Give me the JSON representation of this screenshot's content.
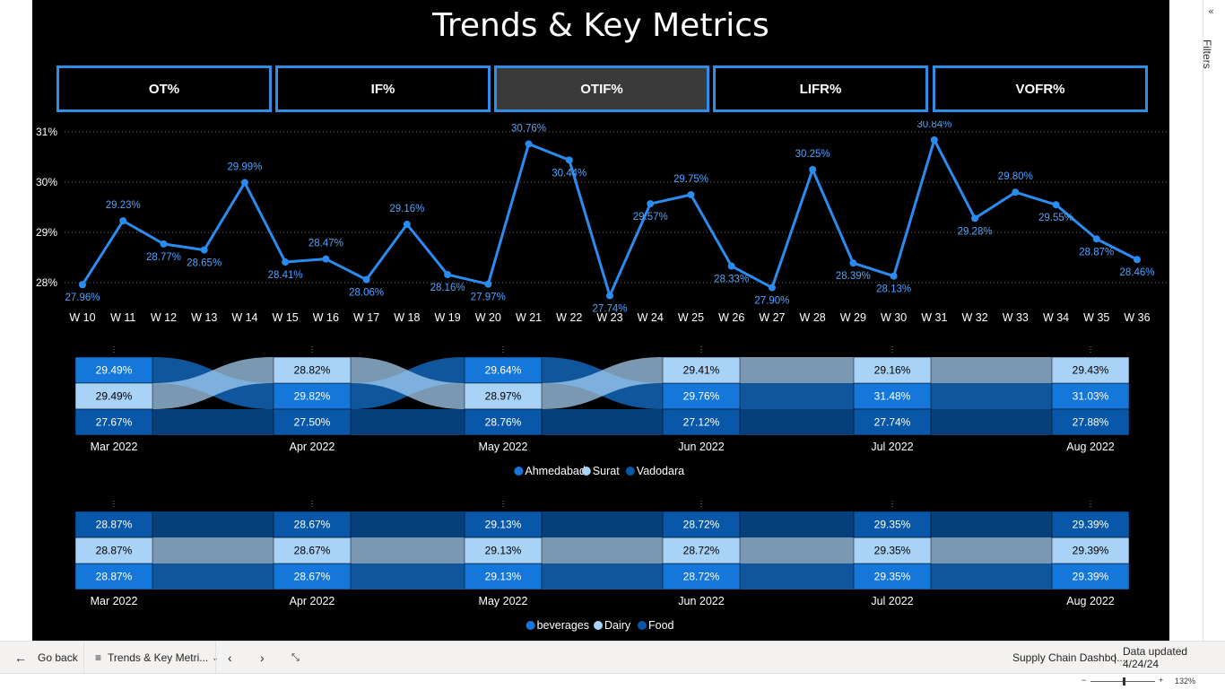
{
  "title": "Trends & Key Metrics",
  "metrics": [
    {
      "label": "OT%",
      "active": false
    },
    {
      "label": "IF%",
      "active": false
    },
    {
      "label": "OTIF%",
      "active": true
    },
    {
      "label": "LIFR%",
      "active": false
    },
    {
      "label": "VOFR%",
      "active": false
    }
  ],
  "colors": {
    "accent": "#2f8fe8",
    "line": "#2b8cf0",
    "label": "#4ea3ff",
    "dark": "#0857a8",
    "mid": "#1577d9",
    "light": "#a9d2f7"
  },
  "chart_data": [
    {
      "type": "line",
      "categories": [
        "W 10",
        "W 11",
        "W 12",
        "W 13",
        "W 14",
        "W 15",
        "W 16",
        "W 17",
        "W 18",
        "W 19",
        "W 20",
        "W 21",
        "W 22",
        "W 23",
        "W 24",
        "W 25",
        "W 26",
        "W 27",
        "W 28",
        "W 29",
        "W 30",
        "W 31",
        "W 32",
        "W 33",
        "W 34",
        "W 35",
        "W 36"
      ],
      "values": [
        27.96,
        29.23,
        28.77,
        28.65,
        29.99,
        28.41,
        28.47,
        28.06,
        29.16,
        28.16,
        27.97,
        30.76,
        30.44,
        27.74,
        29.57,
        29.75,
        28.33,
        27.9,
        30.25,
        28.39,
        28.13,
        30.84,
        29.28,
        29.8,
        29.55,
        28.87,
        28.46
      ],
      "labels": [
        "27.96%",
        "29.23%",
        "28.77%",
        "28.65%",
        "29.99%",
        "28.41%",
        "28.47%",
        "28.06%",
        "29.16%",
        "28.16%",
        "27.97%",
        "30.76%",
        "30.44%",
        "27.74%",
        "29.57%",
        "29.75%",
        "28.33%",
        "27.90%",
        "30.25%",
        "28.39%",
        "28.13%",
        "30.84%",
        "29.28%",
        "29.80%",
        "29.55%",
        "28.87%",
        "28.46%"
      ],
      "yticks": [
        "31%",
        "30%",
        "29%",
        "28%"
      ],
      "ylim": [
        28,
        31
      ],
      "grid": true
    },
    {
      "type": "ribbon",
      "categories": [
        "Mar 2022",
        "Apr 2022",
        "May 2022",
        "Jun 2022",
        "Jul 2022",
        "Aug 2022"
      ],
      "series": [
        {
          "name": "Ahmedabad",
          "values": [
            29.49,
            28.82,
            29.64,
            29.41,
            29.16,
            29.43
          ]
        },
        {
          "name": "Surat",
          "values": [
            29.49,
            29.82,
            28.97,
            29.76,
            31.48,
            31.03
          ]
        },
        {
          "name": "Vadodara",
          "values": [
            27.67,
            27.5,
            28.76,
            27.12,
            27.74,
            27.88
          ]
        }
      ],
      "labels": [
        [
          "29.49%",
          "29.49%",
          "27.67%"
        ],
        [
          "29.82%",
          "28.82%",
          "27.50%"
        ],
        [
          "29.64%",
          "28.97%",
          "28.76%"
        ],
        [
          "29.76%",
          "29.41%",
          "27.12%"
        ],
        [
          "31.48%",
          "29.16%",
          "27.74%"
        ],
        [
          "31.03%",
          "29.43%",
          "27.88%"
        ]
      ],
      "legend": "bottom"
    },
    {
      "type": "ribbon",
      "categories": [
        "Mar 2022",
        "Apr 2022",
        "May 2022",
        "Jun 2022",
        "Jul 2022",
        "Aug 2022"
      ],
      "series": [
        {
          "name": "beverages",
          "values": [
            28.87,
            28.67,
            29.13,
            28.72,
            29.35,
            29.39
          ]
        },
        {
          "name": "Dairy",
          "values": [
            28.87,
            28.67,
            29.13,
            28.72,
            29.35,
            29.39
          ]
        },
        {
          "name": "Food",
          "values": [
            28.87,
            28.67,
            29.13,
            28.72,
            29.35,
            29.39
          ]
        }
      ],
      "labels": [
        [
          "28.87%",
          "28.87%",
          "28.87%"
        ],
        [
          "28.67%",
          "28.67%",
          "28.67%"
        ],
        [
          "29.13%",
          "29.13%",
          "29.13%"
        ],
        [
          "28.72%",
          "28.72%",
          "28.72%"
        ],
        [
          "29.35%",
          "29.35%",
          "29.35%"
        ],
        [
          "29.39%",
          "29.39%",
          "29.39%"
        ]
      ],
      "legend": "bottom"
    }
  ],
  "right_pane": {
    "filters_label": "Filters"
  },
  "footer": {
    "go_back": "Go back",
    "page_tab": "Trends & Key Metri...",
    "report_name": "Supply Chain Dashbo...",
    "data_updated": "Data updated 4/24/24",
    "zoom": "132%"
  }
}
